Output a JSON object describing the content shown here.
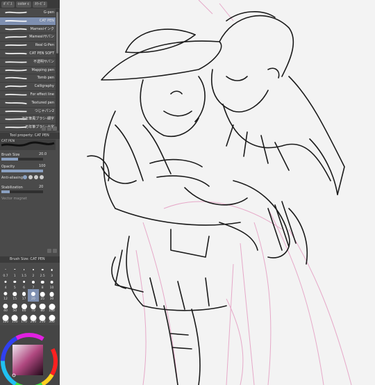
{
  "panel": {
    "tabs": [
      "ｶﾞﾊﾟｽ",
      "color c",
      "ｶﾗｰﾋﾞｽ"
    ],
    "brushes": [
      {
        "label": "G-pen",
        "selected": false
      },
      {
        "label": "CAT PEN",
        "selected": true
      },
      {
        "label": "Mamesiインク",
        "selected": false
      },
      {
        "label": "Mamesiiサパン",
        "selected": false
      },
      {
        "label": "Real G-Pen",
        "selected": false
      },
      {
        "label": "CAT PEN SOFT",
        "selected": false
      },
      {
        "label": "不透明サパン",
        "selected": false
      },
      {
        "label": "Mapping pen",
        "selected": false
      },
      {
        "label": "Tomb pen",
        "selected": false
      },
      {
        "label": "Calligraphy",
        "selected": false
      },
      {
        "label": "For effect line",
        "selected": false
      },
      {
        "label": "Textured pen",
        "selected": false
      },
      {
        "label": "つじゃパン2",
        "selected": false
      },
      {
        "label": "万年筆風ブラシ-細字",
        "selected": false
      },
      {
        "label": "万年筆ブラシ-太字",
        "selected": false
      }
    ],
    "tool_property_header": "Tool property: CAT PEN",
    "tool_name": "CAT PEN",
    "brush_size": {
      "label": "Brush Size",
      "value": "20.0"
    },
    "opacity": {
      "label": "Opacity",
      "value": "100",
      "fraction": 1.0
    },
    "antialiasing": {
      "label": "Anti-aliasing"
    },
    "stabilization": {
      "label": "Stabilization",
      "value": "20",
      "fraction": 0.2
    },
    "vector_magnet": {
      "label": "Vector magnet"
    },
    "brush_size_header": "Brush Size: CAT PEN",
    "sizes": [
      "0.7",
      "1",
      "1.5",
      "2",
      "2.5",
      "3",
      "4",
      "5",
      "6",
      "7",
      "8",
      "10",
      "12",
      "15",
      "17",
      "20",
      "25",
      "30",
      "40",
      "50",
      "60",
      "70",
      "80",
      "100",
      "120",
      "150",
      "170",
      "200",
      "250",
      "300"
    ],
    "selected_size": "20"
  },
  "colors": {
    "panel_bg": "#4a4a4a",
    "selection": "#7e8fb0",
    "canvas_bg": "#f3f3f3",
    "line_art": "#1a1a1a",
    "sketch": "#e6a8c8"
  }
}
